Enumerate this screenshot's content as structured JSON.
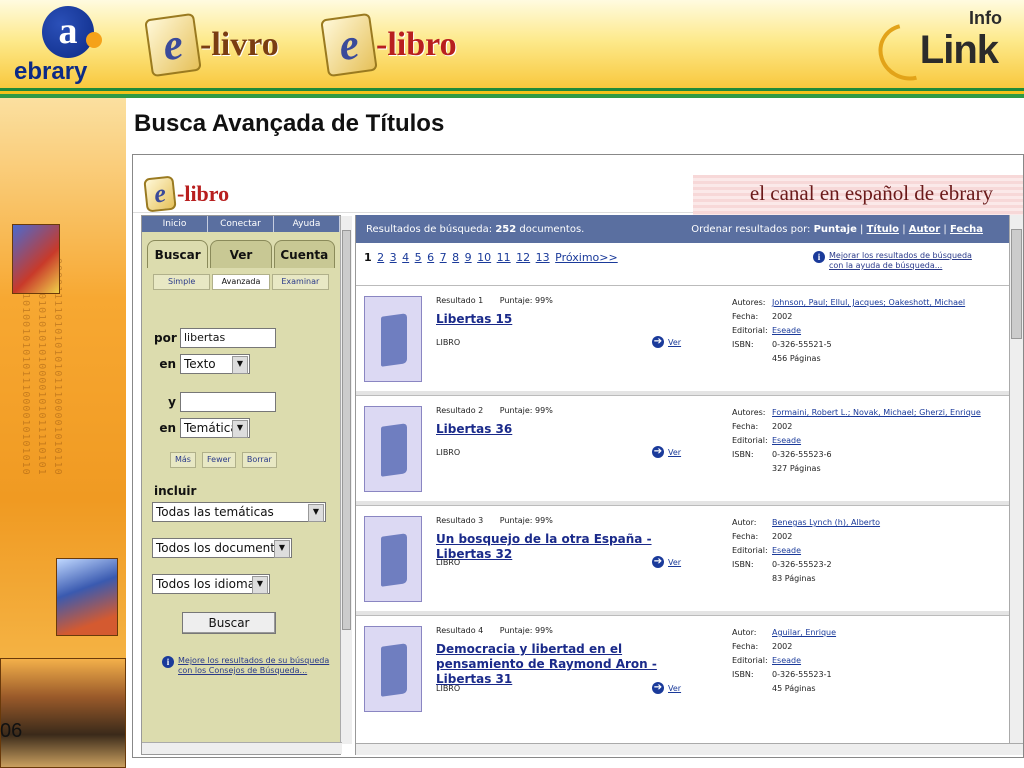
{
  "header": {
    "ebrary_logo_letter": "a",
    "ebrary_logo_text": "ebrary",
    "elivro_letter": "e",
    "elivro_text": "-livro",
    "elibro_letter": "e",
    "elibro_text": "-libro",
    "infolink_top": "Info",
    "infolink_bottom": "Link"
  },
  "slide": {
    "title": "Busca Avançada de Títulos",
    "page_number": "06"
  },
  "screenshot": {
    "logo_letter": "e",
    "logo_text": "-libro",
    "banner_text": "el canal en español de ebrary",
    "nav": [
      "Inicio",
      "Conectar",
      "Ayuda"
    ],
    "tabs": [
      "Buscar",
      "Ver",
      "Cuenta"
    ],
    "subtabs": [
      "Simple",
      "Avanzada",
      "Examinar"
    ],
    "form": {
      "por_label": "por",
      "por_value": "libertas",
      "en1_label": "en",
      "en1_value": "Texto",
      "y_label": "y",
      "y_value": "",
      "en2_label": "en",
      "en2_value": "Temática",
      "btn_mas": "Más",
      "btn_fewer": "Fewer",
      "btn_borrar": "Borrar",
      "incluir_label": "incluir",
      "sel_tematicas": "Todas las temáticas",
      "sel_documentos": "Todos los documentos",
      "sel_idiomas": "Todos los idiomas",
      "buscar_button": "Buscar",
      "tip": "Mejore los resultados de su búsqueda con los Consejos de Búsqueda..."
    },
    "results_bar": {
      "prefix": "Resultados de búsqueda:",
      "count": "252",
      "suffix": "documentos.",
      "sort_label": "Ordenar resultados por:",
      "sort_current": "Puntaje",
      "sort_options": [
        "Título",
        "Autor",
        "Fecha"
      ]
    },
    "pager": {
      "current": "1",
      "pages": [
        "2",
        "3",
        "4",
        "5",
        "6",
        "7",
        "8",
        "9",
        "10",
        "11",
        "12",
        "13"
      ],
      "next": "Próximo>>"
    },
    "right_tip": "Mejorar los resultados de búsqueda con la ayuda de búsqueda...",
    "results": [
      {
        "label": "Resultado 1",
        "score": "Puntaje: 99%",
        "title": "Libertas 15",
        "type": "LIBRO",
        "ver": "Ver",
        "author_key": "Autores:",
        "authors": "Johnson, Paul; Ellul, Jacques; Oakeshott, Michael",
        "fecha_key": "Fecha:",
        "fecha": "2002",
        "editorial_key": "Editorial:",
        "editorial": "Eseade",
        "isbn_key": "ISBN:",
        "isbn": "0-326-55521-5",
        "pages": "456 Páginas"
      },
      {
        "label": "Resultado 2",
        "score": "Puntaje: 99%",
        "title": "Libertas 36",
        "type": "LIBRO",
        "ver": "Ver",
        "author_key": "Autores:",
        "authors": "Formaini, Robert L.; Novak, Michael; Gherzi, Enrique",
        "fecha_key": "Fecha:",
        "fecha": "2002",
        "editorial_key": "Editorial:",
        "editorial": "Eseade",
        "isbn_key": "ISBN:",
        "isbn": "0-326-55523-6",
        "pages": "327 Páginas"
      },
      {
        "label": "Resultado 3",
        "score": "Puntaje: 99%",
        "title": "Un bosquejo de la otra España - Libertas 32",
        "type": "LIBRO",
        "ver": "Ver",
        "author_key": "Autor:",
        "authors": "Benegas Lynch (h), Alberto",
        "fecha_key": "Fecha:",
        "fecha": "2002",
        "editorial_key": "Editorial:",
        "editorial": "Eseade",
        "isbn_key": "ISBN:",
        "isbn": "0-326-55523-2",
        "pages": "83 Páginas"
      },
      {
        "label": "Resultado 4",
        "score": "Puntaje: 99%",
        "title": "Democracia y libertad en el pensamiento de Raymond Aron - Libertas 31",
        "type": "LIBRO",
        "ver": "Ver",
        "author_key": "Autor:",
        "authors": "Aguilar, Enrique",
        "fecha_key": "Fecha:",
        "fecha": "2002",
        "editorial_key": "Editorial:",
        "editorial": "Eseade",
        "isbn_key": "ISBN:",
        "isbn": "0-326-55523-1",
        "pages": "45 Páginas"
      }
    ]
  },
  "colors": {
    "nav_blue": "#5a6fa0",
    "link_blue": "#1a3a9a",
    "panel_olive": "#dcdcae",
    "header_gold": "#f8c537",
    "stripe_green": "#1f8a3a"
  },
  "icons": {
    "info": "info-icon",
    "ver_arrow": "arrow-right-circle-icon",
    "book": "book-icon"
  }
}
